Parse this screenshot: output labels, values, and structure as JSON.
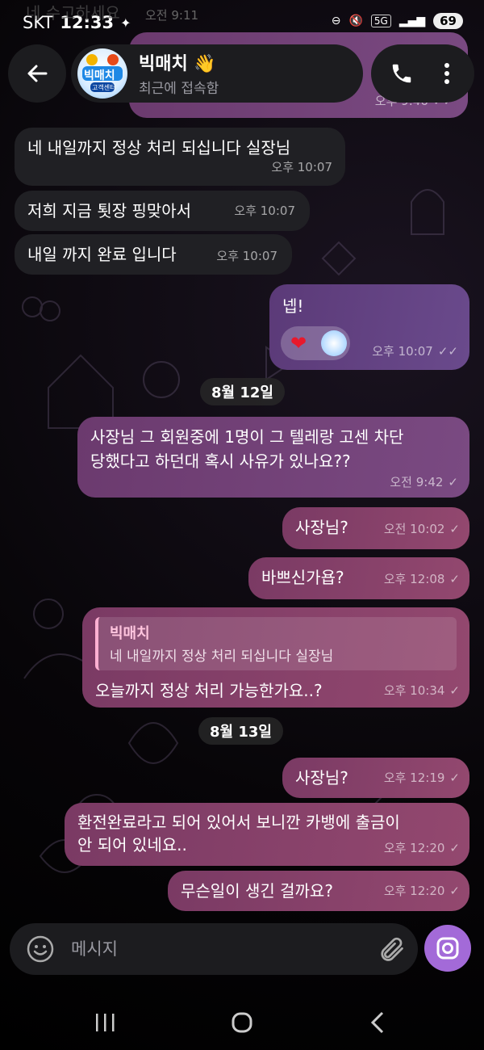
{
  "status_bar": {
    "carrier": "SKT",
    "time": "12:33",
    "network": "5G",
    "battery": "69"
  },
  "ghost_header": {
    "text": "네 수고하세요",
    "time": "오전 9:11"
  },
  "header": {
    "contact_name": "빅매치 👋",
    "contact_status": "최근에 접속함",
    "avatar_text": "빅매치",
    "avatar_sub": "고객센터"
  },
  "messages": {
    "m0_time": "오후 9:46",
    "m1_text": "네 내일까지 정상 처리 되십니다 실장님",
    "m1_time": "오후 10:07",
    "m2_text": "저희 지금 툇장 핑맞아서",
    "m2_time": "오후 10:07",
    "m3_text": "내일 까지 완료 입니다",
    "m3_time": "오후 10:07",
    "m4_text": "넵!",
    "m4_time": "오후 10:07",
    "date1": "8월 12일",
    "m5_line1": "사장님 그 회원중에 1명이 그 텔레랑 고센 차단",
    "m5_line2": "당했다고 하던대 혹시 사유가 있나요??",
    "m5_time": "오전 9:42",
    "m6_text": "사장님?",
    "m6_time": "오전 10:02",
    "m7_text": "바쁘신가욥?",
    "m7_time": "오후 12:08",
    "m8_reply_name": "빅매치",
    "m8_reply_text": "네 내일까지 정상 처리 되십니다 실장님",
    "m8_text": "오늘까지 정상 처리 가능한가요..?",
    "m8_time": "오후 10:34",
    "date2": "8월 13일",
    "m9_text": "사장님?",
    "m9_time": "오후 12:19",
    "m10_line1": "환전완료라고 되어 있어서 보니깐 카뱅에 출금이",
    "m10_line2": "안 되어 있네요..",
    "m10_time": "오후 12:20",
    "m11_text": "무슨일이 생긴 걸까요?",
    "m11_time": "오후 12:20"
  },
  "input": {
    "placeholder": "메시지"
  },
  "colors": {
    "accent": "#a36ad8",
    "outgoing": "#7a4a82",
    "incoming": "#202024"
  }
}
